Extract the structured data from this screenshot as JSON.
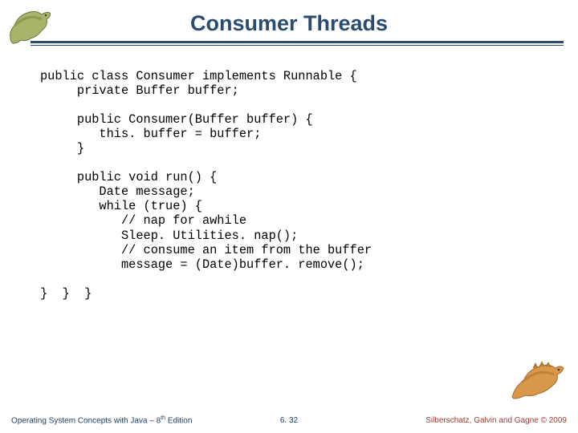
{
  "header": {
    "title": "Consumer Threads"
  },
  "code": {
    "l1": "public class Consumer implements Runnable {",
    "l2": "     private Buffer buffer;",
    "l3": "",
    "l4": "     public Consumer(Buffer buffer) {",
    "l5": "        this. buffer = buffer;",
    "l6": "     }",
    "l7": "",
    "l8": "     public void run() {",
    "l9": "        Date message;",
    "l10": "        while (true) {",
    "l11": "           // nap for awhile",
    "l12": "           Sleep. Utilities. nap();",
    "l13": "           // consume an item from the buffer",
    "l14": "           message = (Date)buffer. remove();",
    "l15": "",
    "l16": "}  }  }"
  },
  "footer": {
    "left_prefix": "Operating System Concepts with Java – 8",
    "left_sup": "th",
    "left_suffix": " Edition",
    "center": "6. 32",
    "right": "Silberschatz, Galvin and Gagne © 2009"
  }
}
